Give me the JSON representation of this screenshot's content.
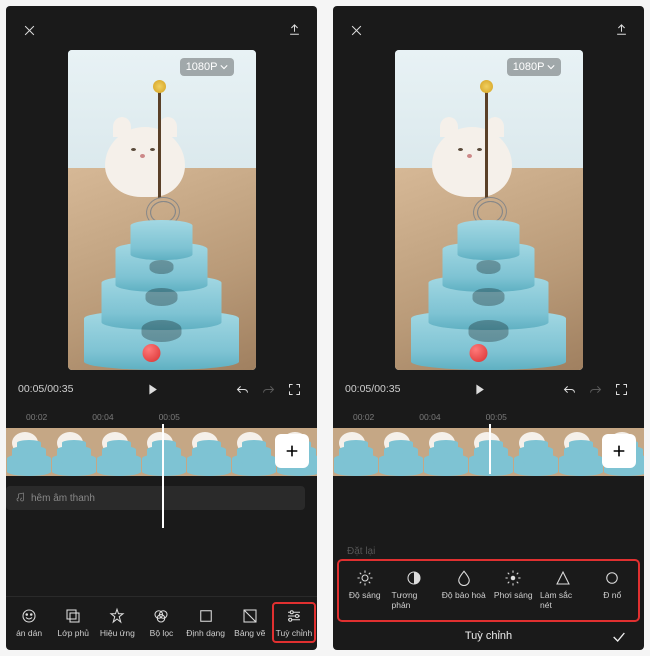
{
  "resolution_badge": "1080P",
  "timecode": {
    "current": "00:05",
    "total": "00:35",
    "combined": "00:05/00:35"
  },
  "ruler_marks": [
    "00:02",
    "00:04",
    "00:05"
  ],
  "audio_track_label": "hêm âm thanh",
  "tools_main": [
    {
      "id": "sticker",
      "label": "án dán"
    },
    {
      "id": "overlay",
      "label": "Lớp phủ"
    },
    {
      "id": "effect",
      "label": "Hiệu ứng"
    },
    {
      "id": "filter",
      "label": "Bộ lọc"
    },
    {
      "id": "format",
      "label": "Định dạng"
    },
    {
      "id": "canvas",
      "label": "Bảng vẽ"
    },
    {
      "id": "adjust",
      "label": "Tuỳ chỉnh",
      "highlight": true
    }
  ],
  "adjust": {
    "reset_label": "Đặt lại",
    "options": [
      {
        "id": "brightness",
        "label": "Độ sáng"
      },
      {
        "id": "contrast",
        "label": "Tương phản"
      },
      {
        "id": "saturation",
        "label": "Độ bảo hoà"
      },
      {
        "id": "exposure",
        "label": "Phơi sáng"
      },
      {
        "id": "sharpen",
        "label": "Làm sắc nét"
      },
      {
        "id": "more",
        "label": "Đ nổ"
      }
    ],
    "confirm_title": "Tuỳ chỉnh"
  }
}
